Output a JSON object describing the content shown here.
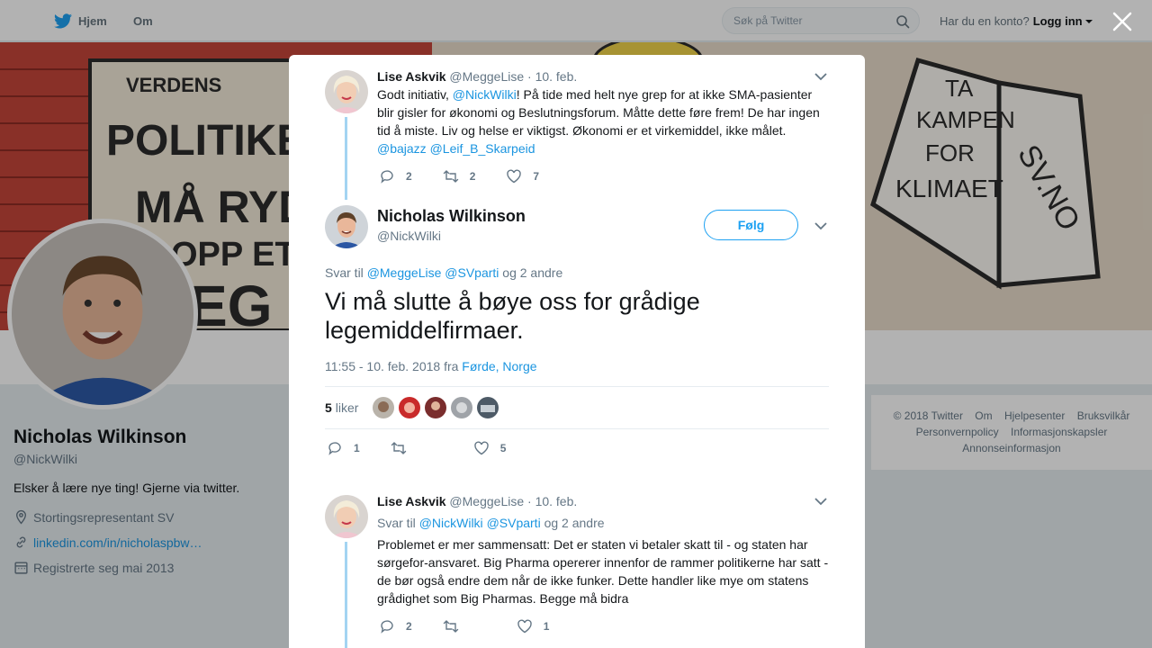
{
  "nav": {
    "home_label": "Hjem",
    "about_label": "Om",
    "search_placeholder": "Søk på Twitter",
    "login_prompt": "Har du en konto?",
    "login_label": "Logg inn"
  },
  "banner": {
    "left_sign_words": [
      "VERDENS",
      "POLITIKERE",
      "MÅ RYDDE",
      "OPP ETTER",
      "EG"
    ],
    "right_sign_words": [
      "TA",
      "KAMPEN",
      "FOR",
      "KLIMAET",
      "SV.NO"
    ]
  },
  "profile": {
    "name": "Nicholas Wilkinson",
    "handle": "@NickWilki",
    "bio": "Elsker å lære nye ting! Gjerne via twitter.",
    "location": "Stortingsrepresentant SV",
    "website": "linkedin.com/in/nicholaspbw…",
    "joined": "Registrerte seg mai 2013"
  },
  "footer": {
    "links": [
      "© 2018 Twitter",
      "Om",
      "Hjelpesenter",
      "Bruksvilkår",
      "Personvernpolicy",
      "Informasjonskapsler",
      "Annonseinformasjon"
    ]
  },
  "modal": {
    "parent_tweet": {
      "name": "Lise Askvik",
      "handle": "@MeggeLise",
      "date": "· 10. feb.",
      "text_1": "Godt initiativ, ",
      "mention_1": "@NickWilki",
      "text_2": "! På tide med helt nye grep for at ikke SMA-pasienter blir gisler for økonomi og Beslutningsforum. Måtte dette føre frem! De har ingen tid å miste. Liv og helse er viktigst. Økonomi er et virkemiddel, ikke målet.",
      "mention_2": "@bajazz",
      "mention_3": "@Leif_B_Skarpeid",
      "replies": "2",
      "retweets": "2",
      "likes": "7"
    },
    "main_tweet": {
      "name": "Nicholas Wilkinson",
      "handle": "@NickWilki",
      "follow_label": "Følg",
      "reply_prefix": "Svar til",
      "reply_mention_1": "@MeggeLise",
      "reply_mention_2": "@SVparti",
      "reply_suffix": "og 2 andre",
      "text": "Vi må slutte å bøye oss for grådige legemiddelfirmaer.",
      "timestamp": "11:55 - 10. feb. 2018 fra",
      "location": "Førde, Norge",
      "likes_count": "5",
      "likes_label": "liker",
      "replies": "1",
      "retweets": "",
      "likes": "5"
    },
    "reply_tweet": {
      "name": "Lise Askvik",
      "handle": "@MeggeLise",
      "date": "· 10. feb.",
      "reply_prefix": "Svar til",
      "reply_mention_1": "@NickWilki",
      "reply_mention_2": "@SVparti",
      "reply_suffix": "og 2 andre",
      "text": "Problemet er mer sammensatt: Det er staten vi betaler skatt til - og staten har sørgefor-ansvaret. Big Pharma opererer innenfor de rammer politikerne har satt - de bør også endre dem når de ikke funker. Dette handler like mye om statens grådighet som Big Pharmas. Begge må bidra",
      "replies": "2",
      "retweets": "",
      "likes": "1"
    }
  },
  "colors": {
    "link": "#1b95e0",
    "brand": "#1da1f2",
    "thread_line": "#a3d4f2"
  }
}
